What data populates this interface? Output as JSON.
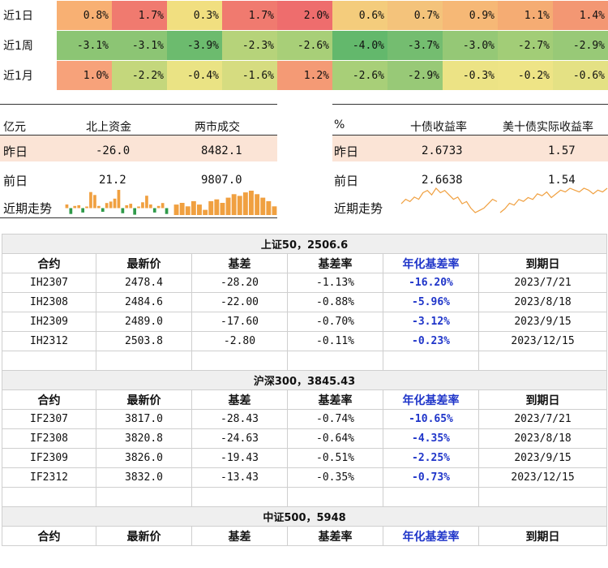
{
  "heatmap": {
    "rows": [
      {
        "label": "近1日",
        "values": [
          "0.8%",
          "1.7%",
          "0.3%",
          "1.7%",
          "2.0%",
          "0.6%",
          "0.7%",
          "0.9%",
          "1.1%",
          "1.4%"
        ],
        "colors": [
          "#f8b073",
          "#f07a6f",
          "#f1df80",
          "#f07a6f",
          "#ee6d6d",
          "#f4cc7c",
          "#f4c37b",
          "#f6b876",
          "#f5ac73",
          "#f39773"
        ]
      },
      {
        "label": "近1周",
        "values": [
          "-3.1%",
          "-3.1%",
          "-3.9%",
          "-2.3%",
          "-2.6%",
          "-4.0%",
          "-3.7%",
          "-3.0%",
          "-2.7%",
          "-2.9%"
        ],
        "colors": [
          "#8cc574",
          "#8cc574",
          "#6cbb6e",
          "#b6d37a",
          "#a8cf78",
          "#63b86c",
          "#74bd70",
          "#95c876",
          "#a2cd77",
          "#98c977"
        ]
      },
      {
        "label": "近1月",
        "values": [
          "1.0%",
          "-2.2%",
          "-0.4%",
          "-1.6%",
          "1.2%",
          "-2.6%",
          "-2.9%",
          "-0.3%",
          "-0.2%",
          "-0.6%"
        ],
        "colors": [
          "#f7a27a",
          "#c4d77c",
          "#eae384",
          "#d6dc80",
          "#f49a75",
          "#a8cf78",
          "#98c977",
          "#ece385",
          "#eee486",
          "#e4e184"
        ]
      }
    ]
  },
  "flow_box": {
    "unit": "亿元",
    "col1": "北上资金",
    "col2": "两市成交",
    "row1_label": "昨日",
    "row1": [
      "-26.0",
      "8482.1"
    ],
    "row2_label": "前日",
    "row2": [
      "21.2",
      "9807.0"
    ],
    "trend_label": "近期走势",
    "bars1": [
      0.5,
      -0.8,
      0.3,
      0.4,
      -0.6,
      0.2,
      2.2,
      1.8,
      0.3,
      -0.5,
      0.7,
      0.9,
      1.3,
      2.5,
      -0.7,
      0.4,
      0.6,
      -0.9,
      0.2,
      0.8,
      1.7,
      0.5,
      -0.6,
      0.3,
      0.7,
      -0.8
    ],
    "bars2": [
      6,
      7,
      5,
      8,
      6,
      3,
      8,
      9,
      7,
      10,
      12,
      11,
      13,
      14,
      12,
      10,
      8,
      5
    ],
    "bar_color_pos": "#f0a040",
    "bar_color_neg": "#2f9a4a"
  },
  "yield_box": {
    "unit": "%",
    "col1": "十债收益率",
    "col2": "美十债实际收益率",
    "row1_label": "昨日",
    "row1": [
      "2.6733",
      "1.57"
    ],
    "row2_label": "前日",
    "row2": [
      "2.6638",
      "1.54"
    ],
    "trend_label": "近期走势",
    "line1": [
      2.64,
      2.66,
      2.65,
      2.67,
      2.66,
      2.69,
      2.7,
      2.68,
      2.71,
      2.69,
      2.7,
      2.68,
      2.66,
      2.67,
      2.64,
      2.65,
      2.62,
      2.6,
      2.61,
      2.62,
      2.64,
      2.66,
      2.65
    ],
    "line2": [
      1.45,
      1.47,
      1.5,
      1.49,
      1.52,
      1.51,
      1.53,
      1.52,
      1.55,
      1.54,
      1.56,
      1.53,
      1.55,
      1.57,
      1.56,
      1.58,
      1.57,
      1.56,
      1.58,
      1.57,
      1.55,
      1.57,
      1.56,
      1.58
    ],
    "line_color": "#f0a040"
  },
  "futures": {
    "col_headers": [
      "合约",
      "最新价",
      "基差",
      "基差率",
      "年化基差率",
      "到期日"
    ],
    "groups": [
      {
        "title": "上证50，2506.6",
        "rows": [
          [
            "IH2307",
            "2478.4",
            "-28.20",
            "-1.13%",
            "-16.20%",
            "2023/7/21"
          ],
          [
            "IH2308",
            "2484.6",
            "-22.00",
            "-0.88%",
            "-5.96%",
            "2023/8/18"
          ],
          [
            "IH2309",
            "2489.0",
            "-17.60",
            "-0.70%",
            "-3.12%",
            "2023/9/15"
          ],
          [
            "IH2312",
            "2503.8",
            "-2.80",
            "-0.11%",
            "-0.23%",
            "2023/12/15"
          ]
        ]
      },
      {
        "title": "沪深300，3845.43",
        "rows": [
          [
            "IF2307",
            "3817.0",
            "-28.43",
            "-0.74%",
            "-10.65%",
            "2023/7/21"
          ],
          [
            "IF2308",
            "3820.8",
            "-24.63",
            "-0.64%",
            "-4.35%",
            "2023/8/18"
          ],
          [
            "IF2309",
            "3826.0",
            "-19.43",
            "-0.51%",
            "-2.25%",
            "2023/9/15"
          ],
          [
            "IF2312",
            "3832.0",
            "-13.43",
            "-0.35%",
            "-0.73%",
            "2023/12/15"
          ]
        ]
      },
      {
        "title": "中证500，5948",
        "rows": []
      }
    ],
    "accent_color": "#1f35c9"
  }
}
